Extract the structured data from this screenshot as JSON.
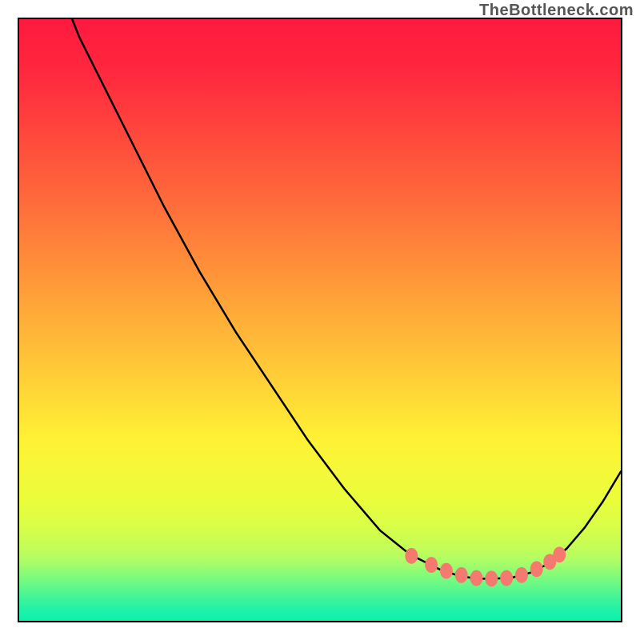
{
  "watermark": "TheBottleneck.com",
  "plot": {
    "border_color": "#000000",
    "gradient_stops": [
      {
        "offset": 0.0,
        "color": "#ff193f"
      },
      {
        "offset": 0.1,
        "color": "#ff2b3e"
      },
      {
        "offset": 0.2,
        "color": "#ff4a3c"
      },
      {
        "offset": 0.3,
        "color": "#ff6a3b"
      },
      {
        "offset": 0.4,
        "color": "#ff8c39"
      },
      {
        "offset": 0.5,
        "color": "#ffae38"
      },
      {
        "offset": 0.6,
        "color": "#ffd037"
      },
      {
        "offset": 0.7,
        "color": "#fff235"
      },
      {
        "offset": 0.8,
        "color": "#eafd3b"
      },
      {
        "offset": 0.85,
        "color": "#d6fd4a"
      },
      {
        "offset": 0.88,
        "color": "#c2fd58"
      },
      {
        "offset": 0.9,
        "color": "#aefd66"
      },
      {
        "offset": 0.92,
        "color": "#8afc76"
      },
      {
        "offset": 0.94,
        "color": "#67f986"
      },
      {
        "offset": 0.96,
        "color": "#44f596"
      },
      {
        "offset": 0.98,
        "color": "#21f2a5"
      },
      {
        "offset": 1.0,
        "color": "#0df0b0"
      }
    ],
    "curve_color": "#000000",
    "curve_width": 2.5,
    "marker_color": "#f47a6f",
    "marker_radius_x": 8,
    "marker_radius_y": 10
  },
  "chart_data": {
    "type": "line",
    "title": "",
    "xlabel": "",
    "ylabel": "",
    "xlim": [
      0,
      100
    ],
    "ylim": [
      0,
      100
    ],
    "note": "Axes are unlabeled in the image. x/y are read as 0–100 fractions of the plot box (x left→right, y bottom→top). Curve is a single black V-shaped line starting at top-left, reaching a flat minimum near x≈78, then rising to the right edge. Salmon beads mark the low region.",
    "series": [
      {
        "name": "curve",
        "x": [
          8.8,
          10.0,
          13.0,
          16.0,
          20.0,
          24.0,
          30.0,
          36.0,
          42.0,
          48.0,
          54.0,
          60.0,
          65.0,
          70.0,
          73.0,
          76.0,
          79.0,
          82.0,
          85.0,
          88.0,
          91.0,
          94.0,
          97.0,
          100.0
        ],
        "y": [
          100.0,
          97.0,
          91.0,
          85.0,
          77.0,
          69.0,
          58.0,
          48.0,
          39.0,
          30.0,
          22.0,
          15.0,
          11.0,
          8.5,
          7.5,
          7.0,
          7.0,
          7.2,
          8.0,
          9.5,
          12.0,
          15.5,
          19.8,
          24.8
        ]
      }
    ],
    "markers": {
      "name": "beads",
      "x": [
        65.2,
        68.5,
        71.0,
        73.5,
        76.0,
        78.5,
        81.0,
        83.5,
        86.0,
        88.2,
        89.8
      ],
      "y": [
        10.8,
        9.3,
        8.3,
        7.6,
        7.1,
        7.0,
        7.1,
        7.6,
        8.6,
        9.8,
        11.0
      ]
    }
  }
}
